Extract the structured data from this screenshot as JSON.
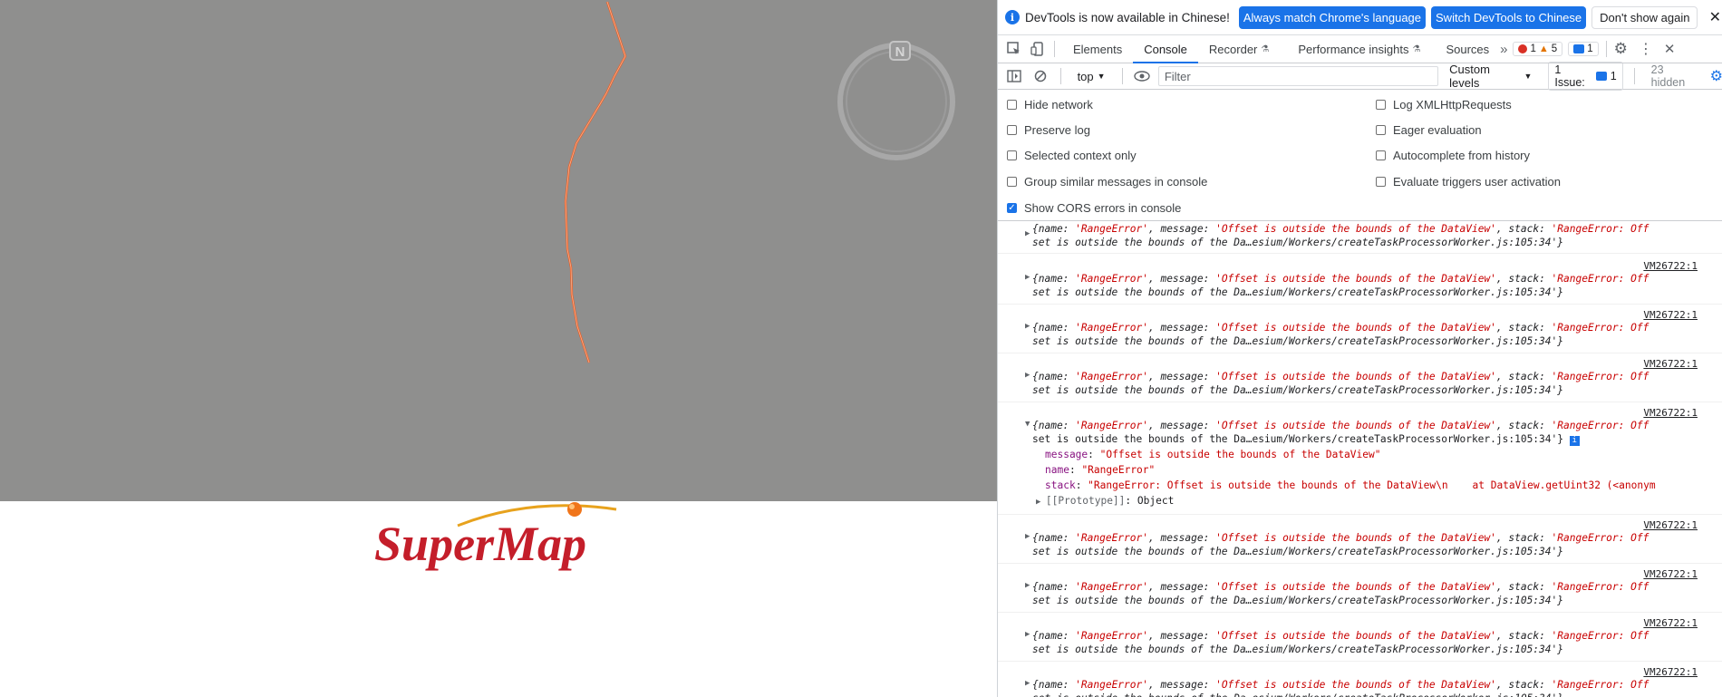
{
  "logo": {
    "text": "SuperMap"
  },
  "compass": {
    "label": "N"
  },
  "devtools": {
    "infobar": {
      "message": "DevTools is now available in Chinese!",
      "btn_match": "Always match Chrome's language",
      "btn_switch": "Switch DevTools to Chinese",
      "btn_dont_show": "Don't show again"
    },
    "tabs": [
      "Elements",
      "Console",
      "Recorder",
      "Performance insights",
      "Sources"
    ],
    "badges": {
      "errors": "1",
      "warnings": "5",
      "messages": "1"
    },
    "toolbar": {
      "context": "top",
      "filter_placeholder": "Filter",
      "levels": "Custom levels",
      "issues_label": "1 Issue:",
      "issues_count": "1",
      "hidden": "23 hidden"
    },
    "settings": {
      "left": [
        "Hide network",
        "Preserve log",
        "Selected context only",
        "Group similar messages in console",
        "Show CORS errors in console"
      ],
      "right": [
        "Log XMLHttpRequests",
        "Eager evaluation",
        "Autocomplete from history",
        "Evaluate triggers user activation"
      ]
    },
    "log": {
      "source": "VM26722:1",
      "line1_a": "{name: ",
      "name_val": "'RangeError'",
      "line1_b": ", message: ",
      "msg_val": "'Offset is outside the bounds of the DataView'",
      "line1_c": ", stack: ",
      "stack_head": "'RangeError: Off",
      "line2": "set is outside the bounds of the Da…esium/Workers/createTaskProcessorWorker.js:105:34'",
      "line2_end": "}",
      "expanded": {
        "message_key": "message",
        "message_val": "\"Offset is outside the bounds of the DataView\"",
        "name_key": "name",
        "name_val": "\"RangeError\"",
        "stack_key": "stack",
        "stack_val": "\"RangeError: Offset is outside the bounds of the DataView\\n    at DataView.getUint32 (<anonym",
        "proto_key": "[[Prototype]]",
        "proto_val": "Object"
      }
    }
  }
}
